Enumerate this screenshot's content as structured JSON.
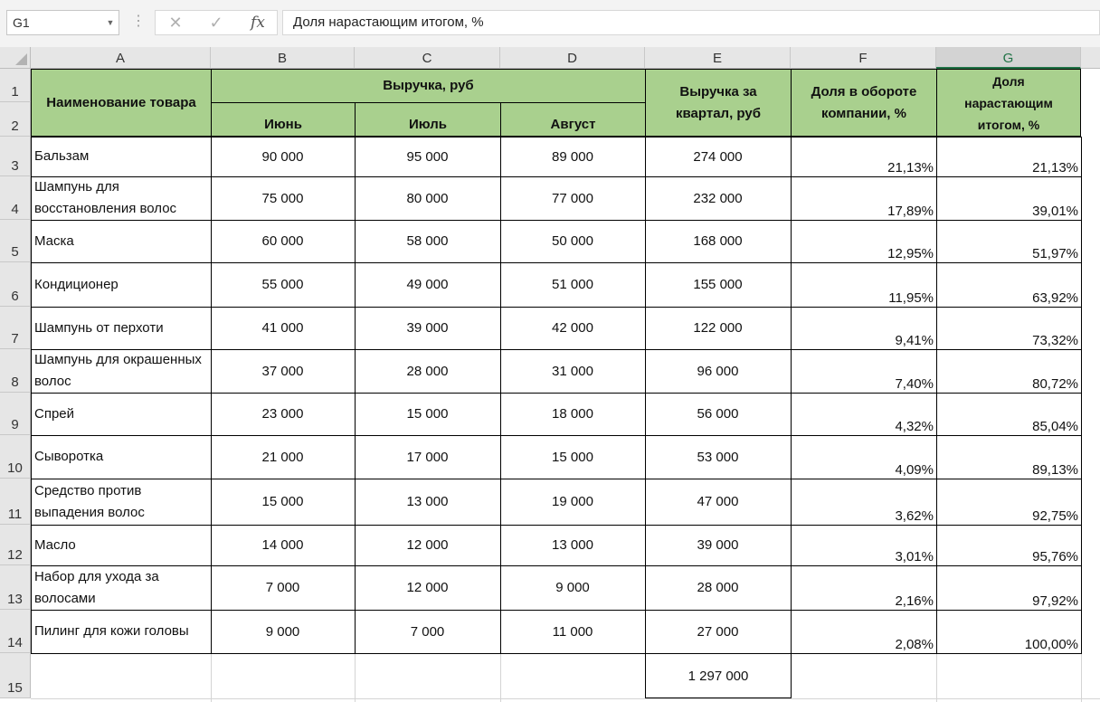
{
  "namebox": {
    "value": "G1"
  },
  "formula_bar": {
    "cancel_icon": "✕",
    "enter_icon": "✓",
    "fx_label": "fx",
    "content": "Доля нарастающим итогом, %"
  },
  "columns": [
    "A",
    "B",
    "C",
    "D",
    "E",
    "F",
    "G"
  ],
  "selected_column": "G",
  "rows": [
    "1",
    "2",
    "3",
    "4",
    "5",
    "6",
    "7",
    "8",
    "9",
    "10",
    "11",
    "12",
    "13",
    "14",
    "15"
  ],
  "headers": {
    "name": "Наименование товара",
    "revenue": "Выручка, руб",
    "june": "Июнь",
    "july": "Июль",
    "august": "Август",
    "quarter": "Выручка за квартал, руб",
    "share": "Доля в обороте компании, %",
    "cumulative": "Доля нарастающим итогом, %"
  },
  "table": [
    {
      "name": "Бальзам",
      "jun": "90 000",
      "jul": "95 000",
      "aug": "89 000",
      "quarter": "274 000",
      "share": "21,13%",
      "cum": "21,13%"
    },
    {
      "name": "Шампунь для восстановления волос",
      "jun": "75 000",
      "jul": "80 000",
      "aug": "77 000",
      "quarter": "232 000",
      "share": "17,89%",
      "cum": "39,01%"
    },
    {
      "name": "Маска",
      "jun": "60 000",
      "jul": "58 000",
      "aug": "50 000",
      "quarter": "168 000",
      "share": "12,95%",
      "cum": "51,97%"
    },
    {
      "name": "Кондиционер",
      "jun": "55 000",
      "jul": "49 000",
      "aug": "51 000",
      "quarter": "155 000",
      "share": "11,95%",
      "cum": "63,92%"
    },
    {
      "name": "Шампунь от перхоти",
      "jun": "41 000",
      "jul": "39 000",
      "aug": "42 000",
      "quarter": "122 000",
      "share": "9,41%",
      "cum": "73,32%"
    },
    {
      "name": "Шампунь для окрашенных волос",
      "jun": "37 000",
      "jul": "28 000",
      "aug": "31 000",
      "quarter": "96 000",
      "share": "7,40%",
      "cum": "80,72%"
    },
    {
      "name": "Спрей",
      "jun": "23 000",
      "jul": "15 000",
      "aug": "18 000",
      "quarter": "56 000",
      "share": "4,32%",
      "cum": "85,04%"
    },
    {
      "name": "Сыворотка",
      "jun": "21 000",
      "jul": "17 000",
      "aug": "15 000",
      "quarter": "53 000",
      "share": "4,09%",
      "cum": "89,13%"
    },
    {
      "name": "Средство против выпадения волос",
      "jun": "15 000",
      "jul": "13 000",
      "aug": "19 000",
      "quarter": "47 000",
      "share": "3,62%",
      "cum": "92,75%"
    },
    {
      "name": "Масло",
      "jun": "14 000",
      "jul": "12 000",
      "aug": "13 000",
      "quarter": "39 000",
      "share": "3,01%",
      "cum": "95,76%"
    },
    {
      "name": "Набор для ухода за волосами",
      "jun": "7 000",
      "jul": "12 000",
      "aug": "9 000",
      "quarter": "28 000",
      "share": "2,16%",
      "cum": "97,92%"
    },
    {
      "name": "Пилинг для кожи головы",
      "jun": "9 000",
      "jul": "7 000",
      "aug": "11 000",
      "quarter": "27 000",
      "share": "2,08%",
      "cum": "100,00%"
    }
  ],
  "total": "1 297 000"
}
